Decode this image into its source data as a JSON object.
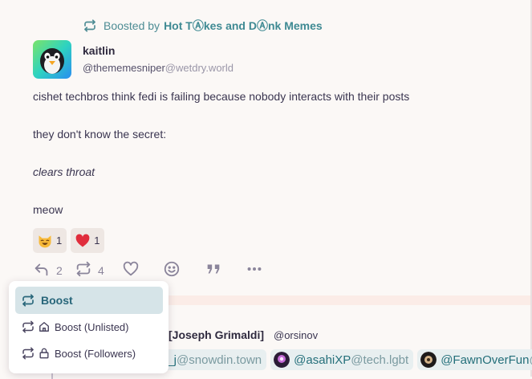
{
  "boost_banner": {
    "prefix": "Boosted by",
    "booster": "Hot TⒶkes and DⒶnk Memes"
  },
  "author": {
    "name": "kaitlin",
    "handle": "@thememesniper",
    "domain": "@wetdry.world"
  },
  "body": {
    "p1": "cishet techbros think fedi is failing because nobody interacts with their posts",
    "p2": "they don't know the secret:",
    "p3": "clears throat",
    "p4": "meow"
  },
  "reactions": [
    {
      "icon": "smiling-cat-emoji",
      "count": "1"
    },
    {
      "icon": "red-heart-emoji",
      "count": "1"
    }
  ],
  "actions": {
    "reply_count": "2",
    "boost_count": "4"
  },
  "boost_menu": {
    "items": [
      {
        "label": "Boost"
      },
      {
        "label": "Boost (Unlisted)"
      },
      {
        "label": "Boost (Followers)"
      }
    ]
  },
  "next_post": {
    "name": "[Joseph Grimaldi]",
    "handle": "@orsinov",
    "mentions": [
      {
        "user": "e_j",
        "domain": "@snowdin.town"
      },
      {
        "user": "@asahiXP",
        "domain": "@tech.lgbt"
      },
      {
        "user": "@FawnOverFun",
        "domain": "@"
      }
    ]
  },
  "colors": {
    "accent": "#3f8a93",
    "selected_bg": "#d6e4e8",
    "heart": "#e02d3c"
  }
}
